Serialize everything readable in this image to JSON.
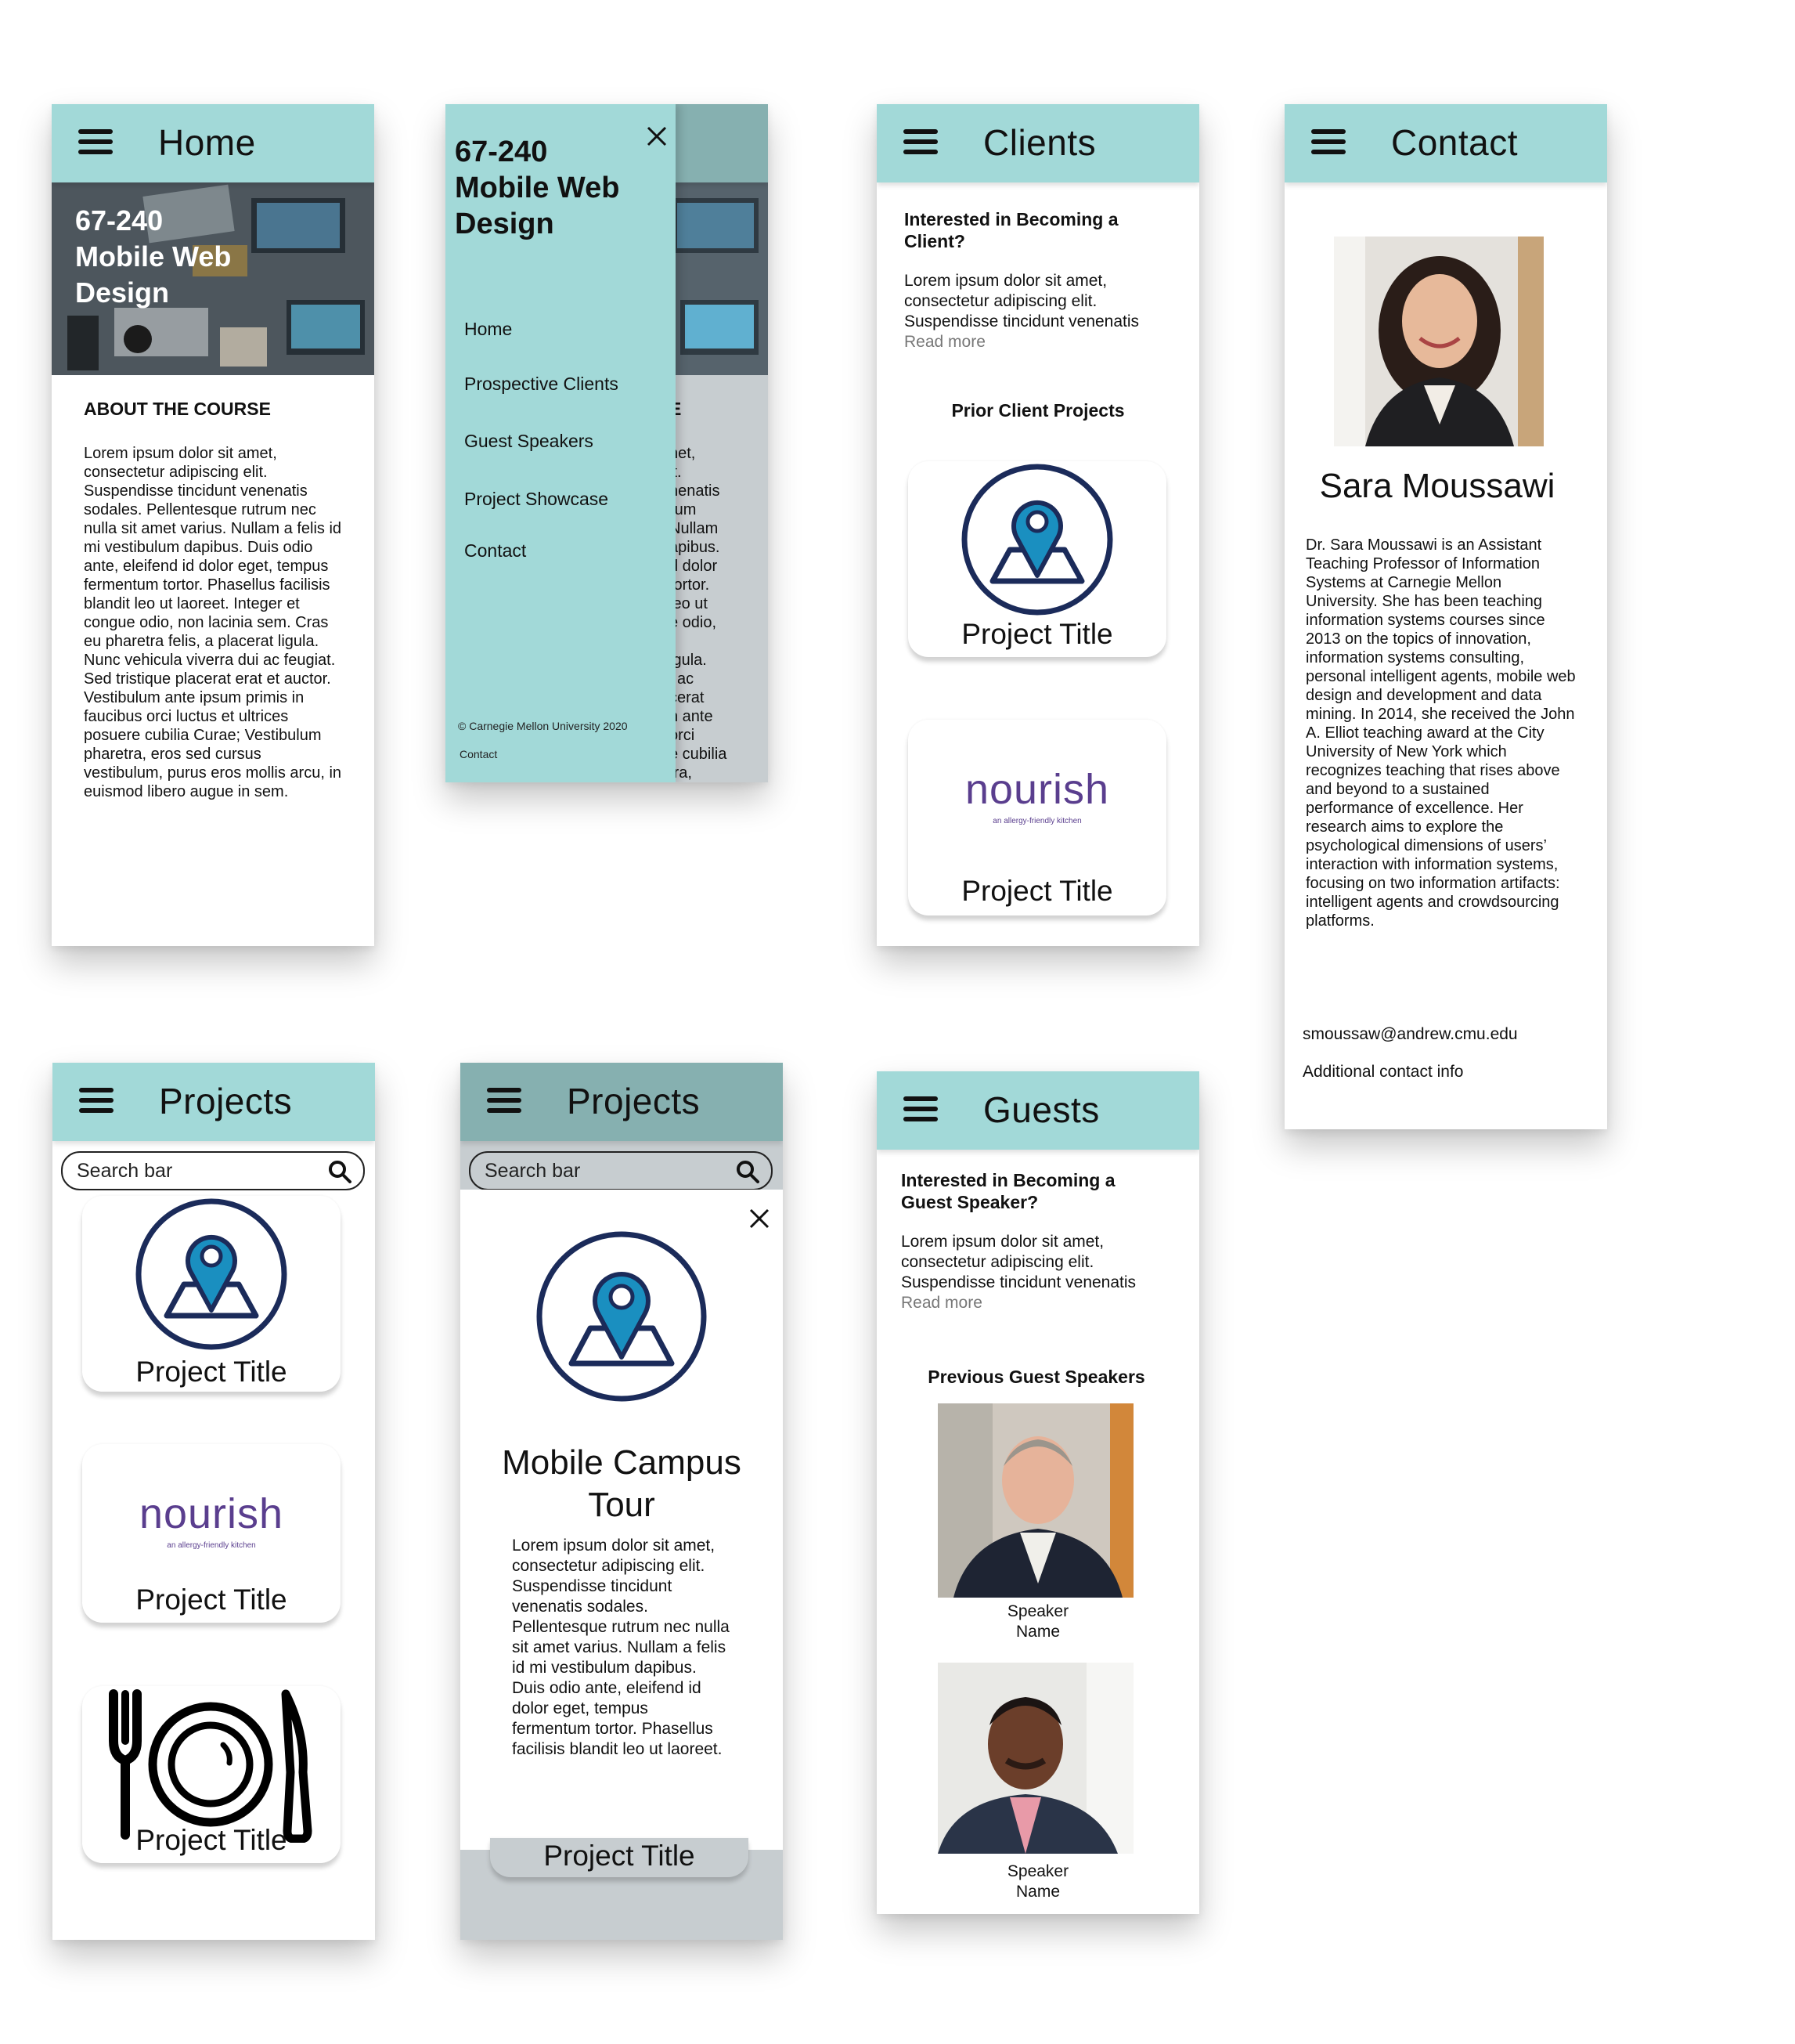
{
  "home": {
    "header_title": "Home",
    "hero_title_1": "67-240",
    "hero_title_2": "Mobile Web",
    "hero_title_3": "Design",
    "about_heading": "ABOUT THE COURSE",
    "about_text": "Lorem ipsum dolor sit amet, consectetur adipiscing elit. Suspendisse tincidunt venenatis sodales. Pellentesque rutrum nec nulla sit amet varius. Nullam a felis id mi vestibulum dapibus. Duis odio ante, eleifend id dolor eget, tempus fermentum tortor. Phasellus facilisis blandit leo ut laoreet. Integer et congue odio, non lacinia sem. Cras eu pharetra felis, a placerat ligula. Nunc vehicula viverra dui ac feugiat. Sed tristique placerat erat et auctor. Vestibulum ante ipsum primis in faucibus orci luctus et ultrices posuere cubilia Curae; Vestibulum pharetra, eros sed cursus vestibulum, purus eros mollis arcu, in euismod libero augue in sem."
  },
  "menu": {
    "title_1": "67-240",
    "title_2": "Mobile Web",
    "title_3": "Design",
    "items": [
      "Home",
      "Prospective Clients",
      "Guest Speakers",
      "Project Showcase",
      "Contact"
    ],
    "footer_copyright": "© Carnegie Mellon University 2020",
    "footer_link": "Contact",
    "peek_lines": [
      "net,",
      "it.",
      "nenatis",
      "rum",
      "Nullam",
      "apibus.",
      "d dolor",
      "tortor.",
      "leo ut",
      "e odio,",
      "",
      "igula.",
      "i ac",
      "cerat",
      "n ante",
      "orci",
      "e cubilia",
      "tra,"
    ],
    "peek_heading": "E"
  },
  "clients": {
    "header_title": "Clients",
    "intro_heading": "Interested in Becoming a Client?",
    "intro_text": "Lorem ipsum dolor sit amet, consectetur adipiscing elit. Suspendisse tincidunt venenatis",
    "read_more": "Read more",
    "prior_heading": "Prior Client Projects",
    "cards": [
      "Project Title",
      "Project Title"
    ],
    "nourish_logo": "nourish",
    "nourish_tagline": "an allergy-friendly kitchen"
  },
  "contact": {
    "header_title": "Contact",
    "name": "Sara Moussawi",
    "bio": "Dr. Sara Moussawi is an Assistant Teaching Professor of Information Systems at Carnegie Mellon University. She has been teaching information systems courses since 2013 on the topics of innovation, information systems consulting, personal intelligent agents, mobile web design and development and data mining. In 2014, she received the John A. Elliot teaching award at the City University of New York which recognizes teaching that rises above and beyond to a sustained performance of excellence. Her research aims to explore the psychological dimensions of users’ interaction with information systems, focusing on two information artifacts: intelligent agents and crowdsourcing platforms.",
    "email": "smoussaw@andrew.cmu.edu",
    "additional": "Additional contact info"
  },
  "projects": {
    "header_title": "Projects",
    "search_placeholder": "Search bar",
    "cards": [
      "Project Title",
      "Project Title",
      "Project Title"
    ],
    "nourish_logo": "nourish",
    "nourish_tagline": "an allergy-friendly kitchen"
  },
  "project_detail": {
    "header_title": "Projects",
    "search_placeholder": "Search bar",
    "title_1": "Mobile Campus",
    "title_2": "Tour",
    "text": "Lorem ipsum dolor sit amet, consectetur adipiscing elit. Suspendisse tincidunt venenatis sodales. Pellentesque rutrum nec nulla sit amet varius. Nullam a felis id mi vestibulum dapibus. Duis odio ante, eleifend id dolor eget, tempus fermentum tortor. Phasellus facilisis blandit leo ut laoreet.",
    "bottom_card": "Project Title"
  },
  "guests": {
    "header_title": "Guests",
    "intro_heading": "Interested in Becoming a Guest Speaker?",
    "intro_text": "Lorem ipsum dolor sit amet, consectetur adipiscing elit. Suspendisse tincidunt venenatis",
    "read_more": "Read more",
    "previous_heading": "Previous Guest Speakers",
    "speaker_line_1": "Speaker",
    "speaker_line_2": "Name"
  },
  "colors": {
    "header_teal": "#a2d9d8",
    "icon_navy": "#1b2b5a",
    "icon_blue": "#1a8fc0",
    "nourish_purple": "#5a3e8e"
  }
}
